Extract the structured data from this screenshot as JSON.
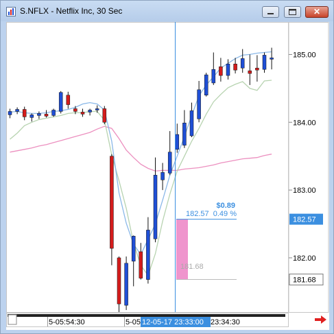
{
  "window": {
    "title": "S.NFLX - Netflix Inc, 30 Sec",
    "minimize_icon": "minimize-icon",
    "maximize_icon": "maximize-icon",
    "close_icon": "close-icon",
    "app_icon": "chart-app-icon"
  },
  "colors": {
    "up_candle": "#1f4fd6",
    "down_candle": "#d41c1c",
    "ma_fast": "#8ab8e8",
    "ma_mid": "#b7d3b0",
    "ma_slow": "#ec8fbf",
    "crosshair": "#3b8fe0",
    "price_label_bg": "#3b8fe0",
    "measure_fill": "#ec83c4",
    "scroll_arrow": "#e02020"
  },
  "time_axis": {
    "labels": [
      "5-05:54:30",
      "5-05",
      "23:34:30"
    ],
    "cursor_label": "12-05-17 23:33:00"
  },
  "measure": {
    "change": "$0.89",
    "price_pct": "182.57  0.49 %",
    "start_price": "181.68"
  },
  "scroll_arrow_icon": "arrow-right-icon",
  "chart_data": {
    "type": "candlestick",
    "title": "S.NFLX - Netflix Inc, 30 Sec",
    "y_ticks": [
      "185.00",
      "184.00",
      "183.00",
      "182.00"
    ],
    "ylim": [
      181.2,
      185.48
    ],
    "price_labels": {
      "current": "182.57",
      "start": "181.68"
    },
    "candles": [
      {
        "open": 184.11,
        "high": 184.2,
        "low": 184.06,
        "close": 184.16
      },
      {
        "open": 184.16,
        "high": 184.22,
        "low": 184.12,
        "close": 184.19
      },
      {
        "open": 184.19,
        "high": 184.23,
        "low": 184.03,
        "close": 184.08
      },
      {
        "open": 184.07,
        "high": 184.13,
        "low": 184.01,
        "close": 184.11
      },
      {
        "open": 184.1,
        "high": 184.16,
        "low": 184.05,
        "close": 184.13
      },
      {
        "open": 184.12,
        "high": 184.18,
        "low": 184.07,
        "close": 184.09
      },
      {
        "open": 184.1,
        "high": 184.2,
        "low": 184.08,
        "close": 184.18
      },
      {
        "open": 184.16,
        "high": 184.46,
        "low": 184.13,
        "close": 184.44
      },
      {
        "open": 184.4,
        "high": 184.45,
        "low": 184.2,
        "close": 184.26
      },
      {
        "open": 184.2,
        "high": 184.24,
        "low": 184.12,
        "close": 184.16
      },
      {
        "open": 184.15,
        "high": 184.2,
        "low": 184.08,
        "close": 184.12
      },
      {
        "open": 184.15,
        "high": 184.2,
        "low": 184.1,
        "close": 184.18
      },
      {
        "open": 184.18,
        "high": 184.25,
        "low": 184.14,
        "close": 184.2
      },
      {
        "open": 184.2,
        "high": 184.24,
        "low": 183.97,
        "close": 184.0
      },
      {
        "open": 183.5,
        "high": 183.53,
        "low": 181.89,
        "close": 182.14
      },
      {
        "open": 182.0,
        "high": 182.02,
        "low": 181.2,
        "close": 181.32
      },
      {
        "open": 181.3,
        "high": 182.02,
        "low": 181.23,
        "close": 181.92
      },
      {
        "open": 181.95,
        "high": 182.33,
        "low": 181.58,
        "close": 182.32
      },
      {
        "open": 182.09,
        "high": 182.22,
        "low": 181.68,
        "close": 181.7
      },
      {
        "open": 181.68,
        "high": 182.6,
        "low": 181.62,
        "close": 182.41
      },
      {
        "open": 182.28,
        "high": 183.48,
        "low": 182.23,
        "close": 183.22
      },
      {
        "open": 183.15,
        "high": 183.4,
        "low": 183.0,
        "close": 183.26
      },
      {
        "open": 183.25,
        "high": 183.87,
        "low": 183.22,
        "close": 183.56
      },
      {
        "open": 183.6,
        "high": 183.98,
        "low": 183.55,
        "close": 183.82
      },
      {
        "open": 183.66,
        "high": 184.18,
        "low": 183.62,
        "close": 183.99
      },
      {
        "open": 183.8,
        "high": 184.29,
        "low": 183.78,
        "close": 184.17
      },
      {
        "open": 184.05,
        "high": 184.61,
        "low": 184.0,
        "close": 184.48
      },
      {
        "open": 184.4,
        "high": 184.73,
        "low": 184.38,
        "close": 184.7
      },
      {
        "open": 184.58,
        "high": 185.03,
        "low": 184.55,
        "close": 184.78
      },
      {
        "open": 184.82,
        "high": 184.95,
        "low": 184.6,
        "close": 184.69
      },
      {
        "open": 184.69,
        "high": 184.93,
        "low": 184.63,
        "close": 184.86
      },
      {
        "open": 184.86,
        "high": 184.95,
        "low": 184.72,
        "close": 184.77
      },
      {
        "open": 184.8,
        "high": 185.08,
        "low": 184.73,
        "close": 184.94
      },
      {
        "open": 184.76,
        "high": 185.0,
        "low": 184.55,
        "close": 184.72
      },
      {
        "open": 184.8,
        "high": 184.99,
        "low": 184.6,
        "close": 184.77
      },
      {
        "open": 184.78,
        "high": 185.03,
        "low": 184.73,
        "close": 184.99
      },
      {
        "open": 184.93,
        "high": 185.1,
        "low": 184.78,
        "close": 184.95
      }
    ],
    "ma_fast": [
      184.15,
      184.16,
      184.14,
      184.13,
      184.13,
      184.14,
      184.16,
      184.17,
      184.19,
      184.22,
      184.27,
      184.29,
      184.27,
      184.18,
      183.72,
      182.96,
      182.51,
      182.2,
      182.05,
      182.27,
      182.5,
      182.85,
      183.22,
      183.5,
      183.79,
      184.1,
      184.39,
      184.55,
      184.67,
      184.8,
      184.87,
      184.94,
      184.99,
      185.0,
      185.02,
      185.03,
      185.04
    ],
    "ma_mid": [
      183.75,
      183.84,
      183.95,
      184.0,
      184.04,
      184.06,
      184.08,
      184.1,
      184.13,
      184.14,
      184.14,
      184.16,
      184.16,
      184.03,
      183.52,
      183.14,
      182.73,
      182.22,
      181.89,
      181.74,
      182.06,
      182.54,
      182.94,
      183.28,
      183.5,
      183.72,
      183.91,
      184.12,
      184.3,
      184.41,
      184.51,
      184.56,
      184.6,
      184.5,
      184.47,
      184.61,
      184.62
    ],
    "ma_slow": [
      183.56,
      183.58,
      183.6,
      183.62,
      183.65,
      183.67,
      183.7,
      183.73,
      183.76,
      183.79,
      183.82,
      183.85,
      183.9,
      183.94,
      183.91,
      183.76,
      183.59,
      183.48,
      183.38,
      183.32,
      183.28,
      183.29,
      183.29,
      183.29,
      183.31,
      183.32,
      183.33,
      183.35,
      183.37,
      183.4,
      183.42,
      183.44,
      183.46,
      183.47,
      183.48,
      183.51,
      183.53
    ]
  }
}
